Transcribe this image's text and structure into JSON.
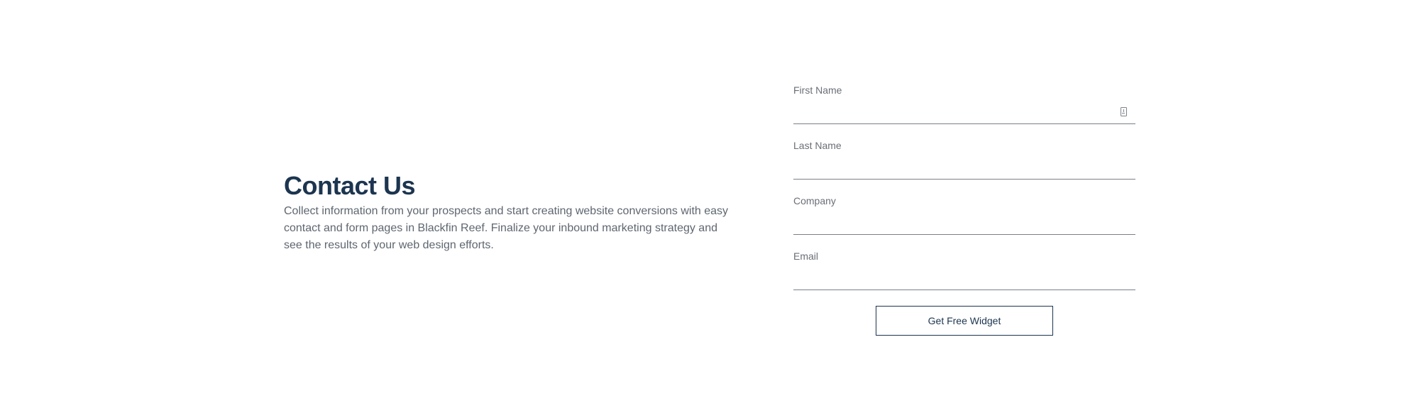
{
  "contact": {
    "title": "Contact Us",
    "description": "Collect information from your prospects and start creating website conversions with easy contact and form pages in Blackfin Reef. Finalize your inbound marketing strategy and see the results of your web design efforts."
  },
  "form": {
    "fields": [
      {
        "label": "First Name",
        "value": "",
        "has_autofill_icon": true
      },
      {
        "label": "Last Name",
        "value": ""
      },
      {
        "label": "Company",
        "value": ""
      },
      {
        "label": "Email",
        "value": ""
      }
    ],
    "submit_label": "Get Free Widget"
  },
  "colors": {
    "heading": "#1c3550",
    "body_text": "#5f6670",
    "button_border": "#1c3550",
    "field_underline": "#7a7f86"
  }
}
